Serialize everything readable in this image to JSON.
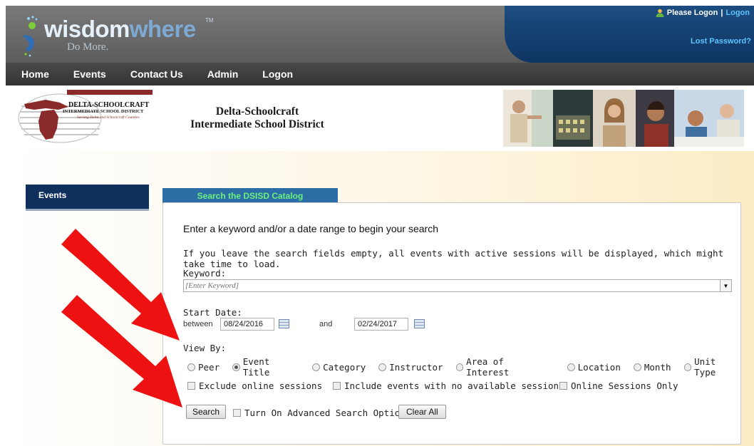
{
  "brand": {
    "word1": "wisdom",
    "word2": "where",
    "trademark": "TM",
    "tagline": "Do More."
  },
  "user_links": {
    "greeting": "Please Logon",
    "separator": "|",
    "logon": "Logon",
    "lost_password": "Lost Password?"
  },
  "nav": {
    "items": [
      "Home",
      "Events",
      "Contact Us",
      "Admin",
      "Logon"
    ]
  },
  "district": {
    "logo_text_top": "DELTA-SCHOOLCRAFT",
    "logo_text_mid": "INTERMEDIATE SCHOOL DISTRICT",
    "logo_text_sub": "Serving Delta and Schoolcraft Counties",
    "name_line1": "Delta-Schoolcraft",
    "name_line2": "Intermediate School District"
  },
  "sidebar": {
    "tab": "Events"
  },
  "search": {
    "tab_title": "Search the DSISD Catalog",
    "heading": "Enter a keyword and/or a date range to begin your search",
    "info": "If you leave the search fields empty, all events with active sessions will be displayed, which might take time to load.",
    "keyword_label": "Keyword:",
    "keyword_placeholder": "[Enter Keyword]",
    "start_date_label": "Start Date:",
    "between_label": "between",
    "date_from": "08/24/2016",
    "and_label": "and",
    "date_to": "02/24/2017",
    "view_by_label": "View By:",
    "view_by_options": [
      "Peer",
      "Event Title",
      "Category",
      "Instructor",
      "Area of Interest",
      "Location",
      "Month",
      "Unit Type"
    ],
    "view_by_selected": "Event Title",
    "exclude_online": "Exclude online sessions",
    "include_no_sessions": "Include events with no available sessions",
    "online_only": "Online Sessions Only",
    "search_button": "Search",
    "advanced_label": "Turn On Advanced Search Options",
    "clear_button": "Clear All"
  },
  "colors": {
    "nav_bg": "#3d3d3d",
    "header_blue": "#0e3563",
    "link_blue": "#5cc4ff",
    "tab_blue": "#2b6ea5",
    "tab_text_green": "#6cf07e",
    "sidebar_navy": "#0f2f5c",
    "arrow_red": "#ee1111"
  }
}
